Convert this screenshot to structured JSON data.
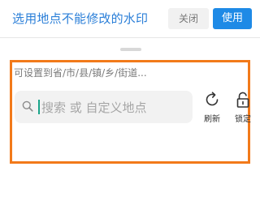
{
  "header": {
    "title": "选用地点不能修改的水印",
    "close_label": "关闭",
    "use_label": "使用"
  },
  "panel": {
    "hint": "可设置到省/市/县/镇/乡/街道...",
    "search": {
      "icon": "search-icon",
      "placeholder": "搜索 或 自定义地点"
    },
    "tools": [
      {
        "icon": "refresh-icon",
        "label": "刷新"
      },
      {
        "icon": "unlock-icon",
        "label": "锁定"
      }
    ]
  },
  "colors": {
    "accent": "#1e8ae6",
    "title": "#2b7fd8",
    "highlight_border": "#f27a1a",
    "cursor": "#1aa58a"
  }
}
